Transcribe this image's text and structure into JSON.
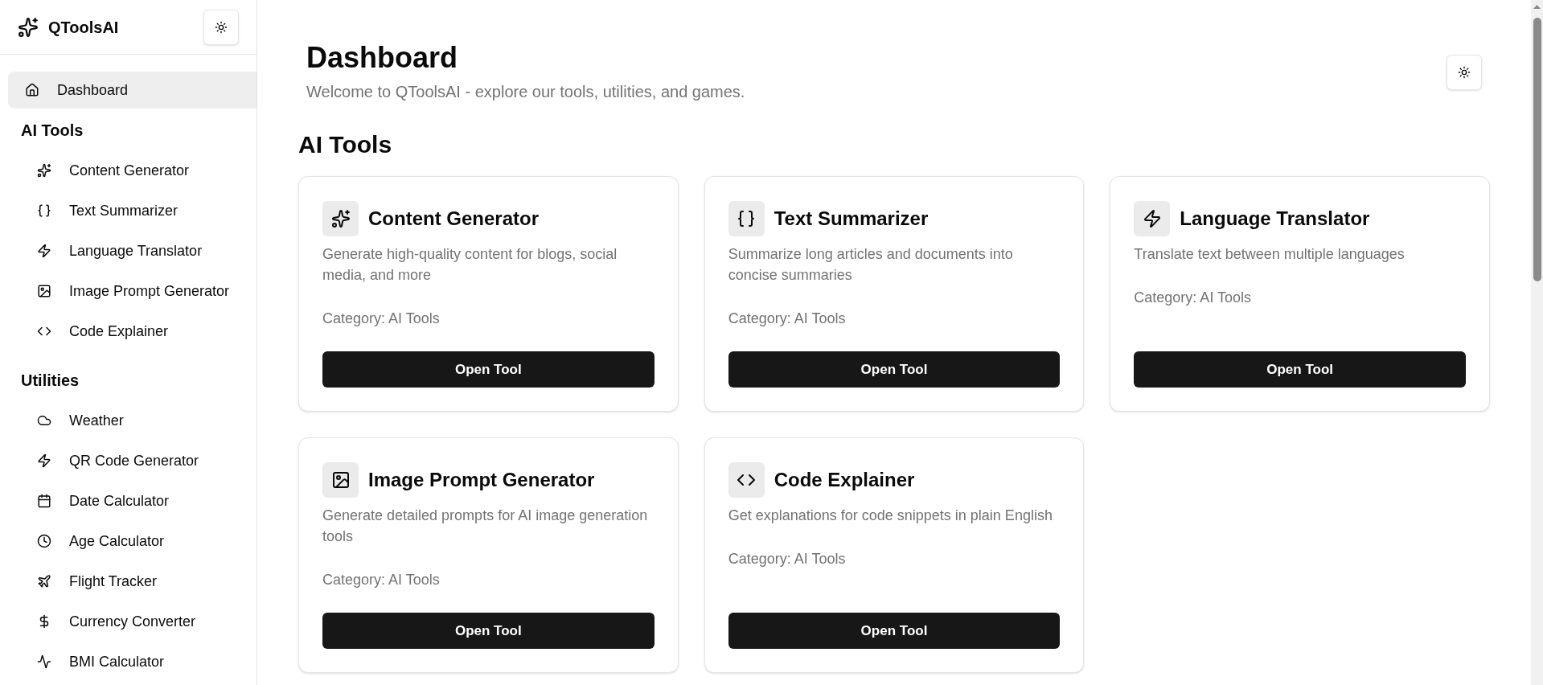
{
  "sidebar": {
    "brand": "QToolsAI",
    "nav": [
      {
        "label": "Dashboard",
        "selected": true
      }
    ],
    "sections": [
      {
        "title": "AI Tools",
        "items": [
          {
            "label": "Content Generator",
            "selected": false
          },
          {
            "label": "Text Summarizer",
            "selected": false
          },
          {
            "label": "Language Translator",
            "selected": false
          },
          {
            "label": "Image Prompt Generator",
            "selected": false
          },
          {
            "label": "Code Explainer",
            "selected": false
          }
        ]
      },
      {
        "title": "Utilities",
        "items": [
          {
            "label": "Weather",
            "selected": false
          },
          {
            "label": "QR Code Generator",
            "selected": false
          },
          {
            "label": "Date Calculator",
            "selected": false
          },
          {
            "label": "Age Calculator",
            "selected": false
          },
          {
            "label": "Flight Tracker",
            "selected": false
          },
          {
            "label": "Currency Converter",
            "selected": false
          },
          {
            "label": "BMI Calculator",
            "selected": false
          }
        ]
      }
    ]
  },
  "main": {
    "title": "Dashboard",
    "subtitle": "Welcome to QToolsAI - explore our tools, utilities, and games.",
    "sections": [
      {
        "title": "AI Tools",
        "cards": [
          {
            "title": "Content Generator",
            "description": "Generate high-quality content for blogs, social media, and more",
            "category": "Category: AI Tools",
            "button": "Open Tool"
          },
          {
            "title": "Text Summarizer",
            "description": "Summarize long articles and documents into concise summaries",
            "category": "Category: AI Tools",
            "button": "Open Tool"
          },
          {
            "title": "Language Translator",
            "description": "Translate text between multiple languages",
            "category": "Category: AI Tools",
            "button": "Open Tool"
          },
          {
            "title": "Image Prompt Generator",
            "description": "Generate detailed prompts for AI image generation tools",
            "category": "Category: AI Tools",
            "button": "Open Tool"
          },
          {
            "title": "Code Explainer",
            "description": "Get explanations for code snippets in plain English",
            "category": "Category: AI Tools",
            "button": "Open Tool"
          }
        ]
      }
    ]
  }
}
